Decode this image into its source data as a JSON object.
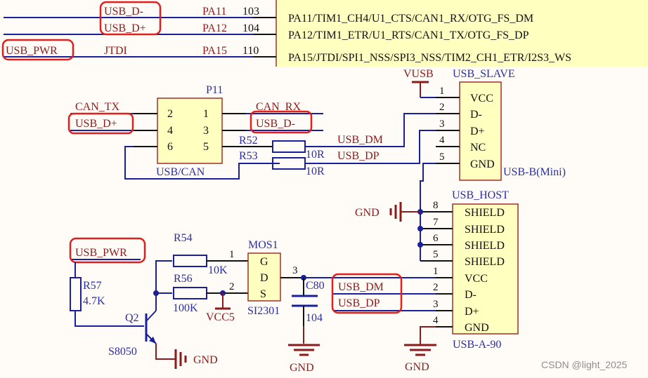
{
  "mcu": {
    "pins": [
      {
        "net": "USB_D-",
        "signal": "",
        "pin": "PA11",
        "number": "103",
        "function": "PA11/TIM1_CH4/U1_CTS/CAN1_RX/OTG_FS_DM",
        "highlighted": true
      },
      {
        "net": "USB_D+",
        "signal": "",
        "pin": "PA12",
        "number": "104",
        "function": "PA12/TIM1_ETR/U1_RTS/CAN1_TX/OTG_FS_DP",
        "highlighted": true
      },
      {
        "net": "USB_PWR",
        "signal": "JTDI",
        "pin": "PA15",
        "number": "110",
        "function": "PA15/JTDI/SPI1_NSS/SPI3_NSS/TIM2_CH1_ETR/I2S3_WS",
        "highlighted": true
      }
    ]
  },
  "p11": {
    "ref": "P11",
    "value": "USB/CAN",
    "left_pins": [
      "2",
      "4",
      "6"
    ],
    "right_pins": [
      "1",
      "3",
      "5"
    ],
    "left_nets": [
      "CAN_TX",
      "USB_D+"
    ],
    "right_nets": [
      "CAN_RX",
      "USB_D-"
    ]
  },
  "resistors": {
    "r52": {
      "ref": "R52",
      "value": "10R"
    },
    "r53": {
      "ref": "R53",
      "value": "10R"
    },
    "r54": {
      "ref": "R54",
      "value": "10K"
    },
    "r56": {
      "ref": "R56",
      "value": "100K"
    },
    "r57": {
      "ref": "R57",
      "value": "4.7K"
    }
  },
  "nets": {
    "usb_dm": "USB_DM",
    "usb_dp": "USB_DP",
    "vusb": "VUSB",
    "gnd": "GND",
    "vcc5": "VCC5",
    "usb_pwr": "USB_PWR"
  },
  "usb_slave": {
    "ref": "USB_SLAVE",
    "value": "USB-B(Mini)",
    "pins": [
      {
        "num": "1",
        "name": "VCC"
      },
      {
        "num": "2",
        "name": "D-"
      },
      {
        "num": "3",
        "name": "D+"
      },
      {
        "num": "4",
        "name": "NC"
      },
      {
        "num": "5",
        "name": "GND"
      }
    ]
  },
  "usb_host": {
    "ref": "USB_HOST",
    "value": "USB-A-90",
    "pins": [
      {
        "num": "8",
        "name": "SHIELD"
      },
      {
        "num": "7",
        "name": "SHIELD"
      },
      {
        "num": "6",
        "name": "SHIELD"
      },
      {
        "num": "5",
        "name": "SHIELD"
      },
      {
        "num": "1",
        "name": "VCC"
      },
      {
        "num": "2",
        "name": "D-"
      },
      {
        "num": "3",
        "name": "D+"
      },
      {
        "num": "4",
        "name": "GND"
      }
    ]
  },
  "mos1": {
    "ref": "MOS1",
    "value": "SI2301",
    "pins": [
      "G",
      "D",
      "S"
    ],
    "pin_numbers": [
      "1",
      "2",
      "3"
    ]
  },
  "q2": {
    "ref": "Q2",
    "value": "S8050"
  },
  "c80": {
    "ref": "C80",
    "value": "104"
  },
  "watermark": "CSDN @light_2025",
  "colors": {
    "wire": "#1a1f9c",
    "net_label": "#8b1a1a",
    "component_fill": "#ffffc0",
    "component_border": "#a0302a",
    "highlight": "#e0201f",
    "background": "#fffcf7"
  }
}
